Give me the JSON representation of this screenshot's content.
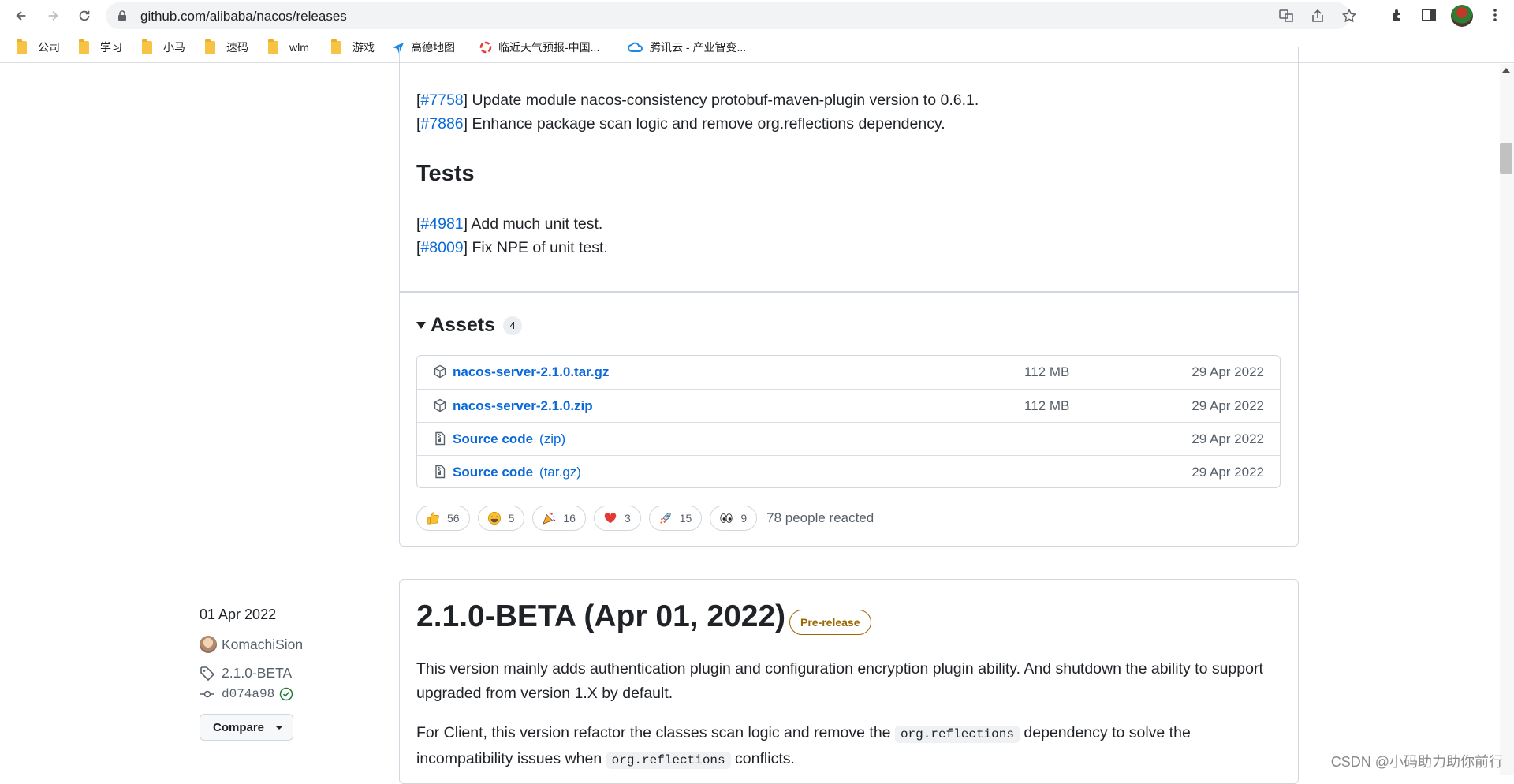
{
  "browser": {
    "url": "github.com/alibaba/nacos/releases",
    "bookmarks": [
      "公司",
      "学习",
      "小马",
      "速码",
      "wlm",
      "游戏",
      "高德地图",
      "临近天气预报-中国...",
      "腾讯云 - 产业智变..."
    ]
  },
  "release1": {
    "notes_top": [
      {
        "issue": "#7758",
        "text": "] Update module nacos-consistency protobuf-maven-plugin version to 0.6.1."
      },
      {
        "issue": "#7886",
        "text": "] Enhance package scan logic and remove org.reflections dependency."
      }
    ],
    "tests_heading": "Tests",
    "tests": [
      {
        "issue": "#4981",
        "text": "] Add much unit test."
      },
      {
        "issue": "#8009",
        "text": "] Fix NPE of unit test."
      }
    ],
    "assets": {
      "title": "Assets",
      "count": "4",
      "items": [
        {
          "name": "nacos-server-2.1.0.tar.gz",
          "format": "",
          "size": "112 MB",
          "date": "29 Apr 2022",
          "icon": "package-icon"
        },
        {
          "name": "nacos-server-2.1.0.zip",
          "format": "",
          "size": "112 MB",
          "date": "29 Apr 2022",
          "icon": "package-icon"
        },
        {
          "name": "Source code",
          "format": "(zip)",
          "size": "",
          "date": "29 Apr 2022",
          "icon": "file-zip-icon"
        },
        {
          "name": "Source code",
          "format": "(tar.gz)",
          "size": "",
          "date": "29 Apr 2022",
          "icon": "file-zip-icon"
        }
      ]
    },
    "reactions": [
      {
        "emoji": "thumbs-up",
        "count": "56"
      },
      {
        "emoji": "laugh",
        "count": "5"
      },
      {
        "emoji": "hooray",
        "count": "16"
      },
      {
        "emoji": "heart",
        "count": "3"
      },
      {
        "emoji": "rocket",
        "count": "15"
      },
      {
        "emoji": "eyes",
        "count": "9"
      }
    ],
    "reacted_text": "78 people reacted"
  },
  "release2": {
    "date": "01 Apr 2022",
    "author": "KomachiSion",
    "tag": "2.1.0-BETA",
    "commit": "d074a98",
    "compare_label": "Compare",
    "title": "2.1.0-BETA (Apr 01, 2022)",
    "badge": "Pre-release",
    "para1": "This version mainly adds authentication plugin and configuration encryption plugin ability. And shutdown the ability to support upgraded from version 1.X by default.",
    "para2_a": "For Client, this version refactor the classes scan logic and remove the ",
    "para2_code1": "org.reflections",
    "para2_b": " dependency to solve the incompatibility issues when ",
    "para2_code2": "org.reflections",
    "para2_c": " conflicts."
  },
  "watermark": "CSDN @小码助力助你前行"
}
